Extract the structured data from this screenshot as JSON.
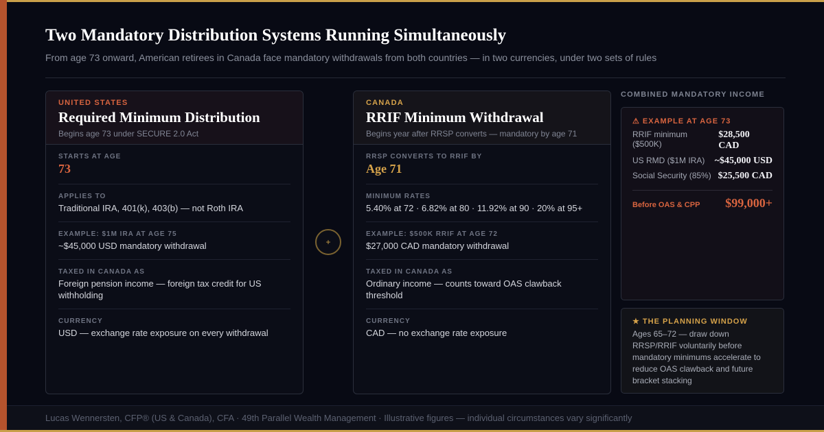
{
  "header": {
    "title": "Two Mandatory Distribution Systems Running Simultaneously",
    "subtitle": "From age 73 onward, American retirees in Canada face mandatory withdrawals from both countries — in two currencies, under two sets of rules"
  },
  "us": {
    "country": "UNITED STATES",
    "title": "Required Minimum Distribution",
    "subtitle": "Begins age 73 under SECURE 2.0 Act",
    "rows": [
      {
        "label": "STARTS AT AGE",
        "value": "73"
      },
      {
        "label": "APPLIES TO",
        "value": "Traditional IRA, 401(k), 403(b) — not Roth IRA"
      },
      {
        "label": "EXAMPLE: $1M IRA AT AGE 75",
        "value": "~$45,000 USD mandatory withdrawal"
      },
      {
        "label": "TAXED IN CANADA AS",
        "value": "Foreign pension income — foreign tax credit for US withholding"
      },
      {
        "label": "CURRENCY",
        "value": "USD — exchange rate exposure on every withdrawal"
      }
    ]
  },
  "canada": {
    "country": "CANADA",
    "title": "RRIF Minimum Withdrawal",
    "subtitle": "Begins year after RRSP converts — mandatory by age 71",
    "rows": [
      {
        "label": "RRSP CONVERTS TO RRIF BY",
        "value": "Age 71"
      },
      {
        "label": "MINIMUM RATES",
        "value": "5.40% at 72 · 6.82% at 80 · 11.92% at 90 · 20% at 95+"
      },
      {
        "label": "EXAMPLE: $500K RRIF AT AGE 72",
        "value": "$27,000 CAD mandatory withdrawal"
      },
      {
        "label": "TAXED IN CANADA AS",
        "value": "Ordinary income — counts toward OAS clawback threshold"
      },
      {
        "label": "CURRENCY",
        "value": "CAD — no exchange rate exposure"
      }
    ]
  },
  "connector": {
    "symbol": "+"
  },
  "combined": {
    "label": "COMBINED MANDATORY INCOME",
    "example_title": "⚠ EXAMPLE AT AGE 73",
    "lines": [
      {
        "label": "RRIF minimum ($500K)",
        "value": "$28,500 CAD"
      },
      {
        "label": "US RMD ($1M IRA)",
        "value": "~$45,000 USD"
      },
      {
        "label": "Social Security (85%)",
        "value": "$25,500 CAD"
      }
    ],
    "total_label": "Before OAS & CPP",
    "total_value": "$99,000+"
  },
  "planning": {
    "title": "★ THE PLANNING WINDOW",
    "body": "Ages 65–72 — draw down RRSP/RRIF voluntarily before mandatory minimums accelerate to reduce OAS clawback and future bracket stacking"
  },
  "footer": {
    "text": "Lucas Wennersten, CFP® (US & Canada), CFA  ·  49th Parallel Wealth Management  ·  Illustrative figures — individual circumstances vary significantly"
  },
  "colors": {
    "background": "#080a14",
    "us_accent": "#d8643f",
    "canada_accent": "#d5a24a",
    "gold_border": "#c9a04a"
  }
}
